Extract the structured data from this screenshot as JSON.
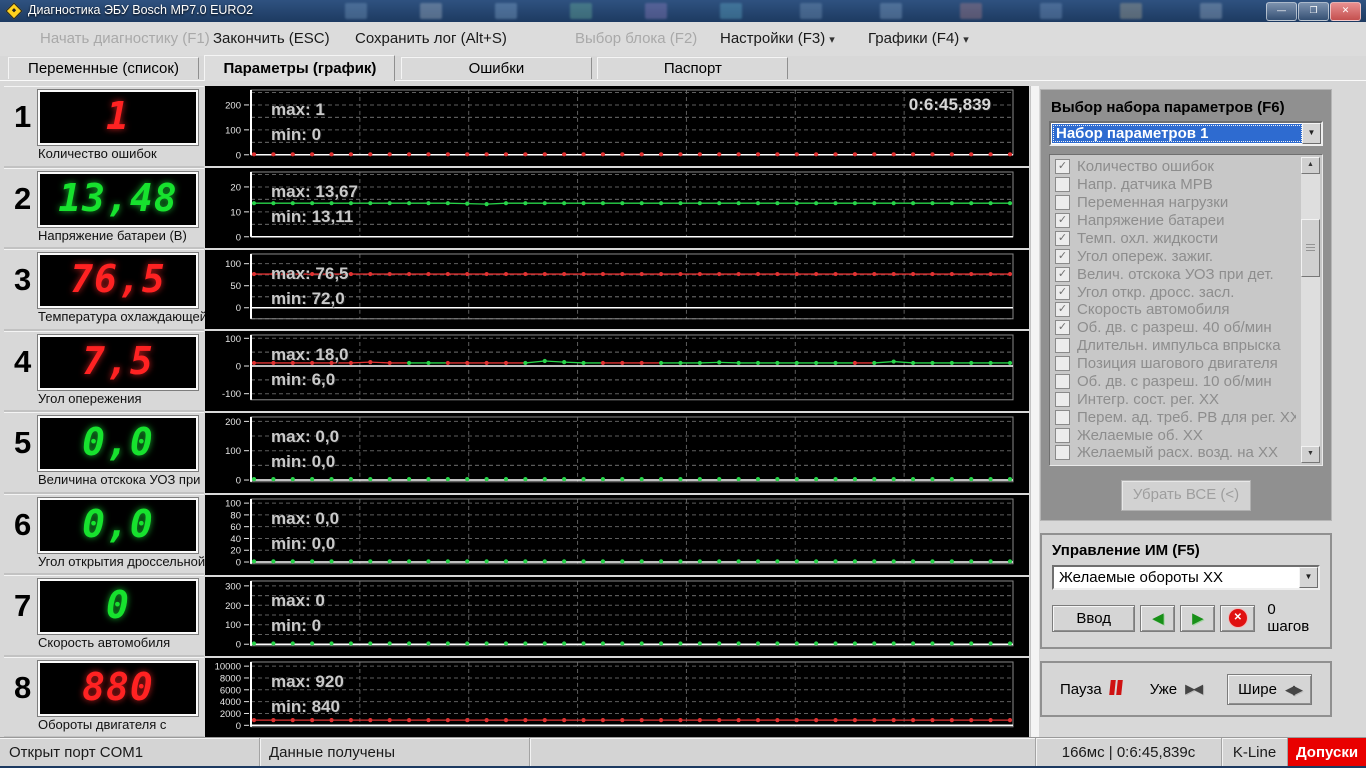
{
  "window": {
    "title": "Диагностика ЭБУ Bosch MP7.0 EURO2"
  },
  "icons": {
    "dropdown": "▾",
    "combo_arrow": "▼",
    "check": "✓",
    "scroll_up": "▲",
    "scroll_down": "▼",
    "left_green": "◀",
    "right_green": "▶",
    "cancel_x": "✕",
    "narrower": "▶◀",
    "wider": "◀▶",
    "minimize": "—",
    "restore": "❐",
    "close": "✕"
  },
  "menu": {
    "items": [
      {
        "label": "Начать диагностику (F1)",
        "enabled": false
      },
      {
        "label": "Закончить (ESC)",
        "enabled": true
      },
      {
        "label": "Сохранить лог (Alt+S)",
        "enabled": true
      },
      {
        "label": "Выбор блока (F2)",
        "enabled": false
      },
      {
        "label": "Настройки (F3)",
        "enabled": true
      },
      {
        "label": "Графики (F4)",
        "enabled": true
      }
    ]
  },
  "tabs": [
    {
      "label": "Переменные (список)",
      "active": false
    },
    {
      "label": "Параметры (график)",
      "active": true
    },
    {
      "label": "Ошибки",
      "active": false
    },
    {
      "label": "Паспорт",
      "active": false
    }
  ],
  "gauges": [
    {
      "index": "1",
      "value": "1",
      "color": "red",
      "label": "Количество ошибок"
    },
    {
      "index": "2",
      "value": "13,48",
      "color": "green",
      "label": "Напряжение батареи (В)"
    },
    {
      "index": "3",
      "value": "76,5",
      "color": "red",
      "label": "Температура охлаждающей"
    },
    {
      "index": "4",
      "value": "7,5",
      "color": "red",
      "label": "Угол опережения"
    },
    {
      "index": "5",
      "value": "0,0",
      "color": "green",
      "label": "Величина отскока УОЗ при"
    },
    {
      "index": "6",
      "value": "0,0",
      "color": "green",
      "label": "Угол открытия дроссельной"
    },
    {
      "index": "7",
      "value": "0",
      "color": "green",
      "label": "Скорость автомобиля"
    },
    {
      "index": "8",
      "value": "880",
      "color": "red",
      "label": "Обороты двигателя с"
    }
  ],
  "chart_data": [
    {
      "type": "line",
      "name": "Количество ошибок",
      "ylim": [
        0,
        260
      ],
      "yticks": [
        0,
        100,
        200
      ],
      "max_label": "max: 1",
      "min_label": "min: 0",
      "timestamp": "0:6:45,839",
      "series": {
        "color": "#e03232",
        "connect": false,
        "value": 2
      }
    },
    {
      "type": "line",
      "name": "Напряжение батареи (В)",
      "ylim": [
        0,
        26
      ],
      "yticks": [
        0,
        10,
        20
      ],
      "max_label": "max: 13,67",
      "min_label": "min: 13,11",
      "series": {
        "color": "#28d44a",
        "connect": true,
        "value": 13.48,
        "anomalies": {
          "11": 13.3,
          "12": 13.11
        }
      }
    },
    {
      "type": "line",
      "name": "Температура охлаждающей",
      "ylim": [
        -25,
        122
      ],
      "yticks": [
        0,
        50,
        100
      ],
      "max_label": "max: 76,5",
      "min_label": "min: 72,0",
      "series": {
        "color": "#e03232",
        "connect": true,
        "value": 76.5
      }
    },
    {
      "type": "line",
      "name": "Угол опережения",
      "ylim": [
        -122,
        112
      ],
      "yticks": [
        -100,
        0,
        100
      ],
      "max_label": "max: 18,0",
      "min_label": "min: 6,0",
      "series": {
        "color": "#e03232",
        "connect": true,
        "value": 11,
        "anomalies": {
          "6": 14,
          "15": 18,
          "16": 14,
          "24": 13,
          "33": 16
        },
        "segments": [
          [
            0,
            0.205,
            "#e03232"
          ],
          [
            0.205,
            0.245,
            "#28d44a"
          ],
          [
            0.245,
            0.355,
            "#e03232"
          ],
          [
            0.355,
            0.46,
            "#28d44a"
          ],
          [
            0.46,
            0.525,
            "#e03232"
          ],
          [
            0.525,
            0.77,
            "#28d44a"
          ],
          [
            0.77,
            0.805,
            "#e03232"
          ],
          [
            0.805,
            1.01,
            "#28d44a"
          ]
        ]
      }
    },
    {
      "type": "line",
      "name": "Величина отскока УОЗ при",
      "ylim": [
        -6,
        215
      ],
      "yticks": [
        0,
        100,
        200
      ],
      "max_label": "max: 0,0",
      "min_label": "min: 0,0",
      "series": {
        "color": "#28d44a",
        "connect": false,
        "value": 3
      }
    },
    {
      "type": "line",
      "name": "Угол открытия дроссельной",
      "ylim": [
        -3,
        107
      ],
      "yticks": [
        0,
        20,
        40,
        60,
        80,
        100
      ],
      "max_label": "max: 0,0",
      "min_label": "min: 0,0",
      "series": {
        "color": "#28d44a",
        "connect": false,
        "value": 1.2
      }
    },
    {
      "type": "line",
      "name": "Скорость автомобиля",
      "ylim": [
        -8,
        325
      ],
      "yticks": [
        0,
        100,
        200,
        300
      ],
      "max_label": "max: 0",
      "min_label": "min: 0",
      "series": {
        "color": "#28d44a",
        "connect": false,
        "value": 4
      }
    },
    {
      "type": "line",
      "name": "Обороты двигателя с",
      "ylim": [
        -250,
        10700
      ],
      "yticks": [
        0,
        2000,
        4000,
        6000,
        8000,
        10000
      ],
      "max_label": "max: 920",
      "min_label": "min: 840",
      "series": {
        "color": "#e03232",
        "connect": true,
        "value": 880
      }
    }
  ],
  "sidebar": {
    "param_set": {
      "title": "Выбор набора параметров (F6)",
      "selected": "Набор параметров 1",
      "remove_all_label": "Убрать ВСЕ (<)",
      "checklist": [
        {
          "label": "Количество ошибок",
          "checked": true
        },
        {
          "label": "Напр. датчика МРВ",
          "checked": false
        },
        {
          "label": "Переменная нагрузки",
          "checked": false
        },
        {
          "label": "Напряжение батареи",
          "checked": true
        },
        {
          "label": "Темп. охл. жидкости",
          "checked": true
        },
        {
          "label": "Угол опереж. зажиг.",
          "checked": true
        },
        {
          "label": "Велич. отскока УОЗ при дет.",
          "checked": true
        },
        {
          "label": "Угол откр. дросс. засл.",
          "checked": true
        },
        {
          "label": "Скорость автомобиля",
          "checked": true
        },
        {
          "label": "Об. дв. с разреш. 40 об/мин",
          "checked": true
        },
        {
          "label": "Длительн. импульса впрыска",
          "checked": false
        },
        {
          "label": "Позиция шагового двигателя",
          "checked": false
        },
        {
          "label": "Об. дв. с разреш. 10 об/мин",
          "checked": false
        },
        {
          "label": "Интегр. сост. рег. ХХ",
          "checked": false
        },
        {
          "label": "Перем. ад. треб. РВ для рег. ХХ",
          "checked": false
        },
        {
          "label": "Желаемые об. ХХ",
          "checked": false
        },
        {
          "label": "Желаемый расх. возд. на ХХ",
          "checked": false
        }
      ]
    },
    "im_control": {
      "title": "Управление ИМ (F5)",
      "selected": "Желаемые обороты ХХ",
      "enter_label": "Ввод",
      "steps_label": "0 шагов"
    },
    "zoom_box": {
      "pause_label": "Пауза",
      "narrower_label": "Уже",
      "wider_label": "Шире"
    }
  },
  "statusbar": {
    "port": "Открыт порт COM1",
    "data_state": "Данные получены",
    "timing": "166мс | 0:6:45,839с",
    "iface": "K-Line",
    "tolerances": "Допуски"
  }
}
